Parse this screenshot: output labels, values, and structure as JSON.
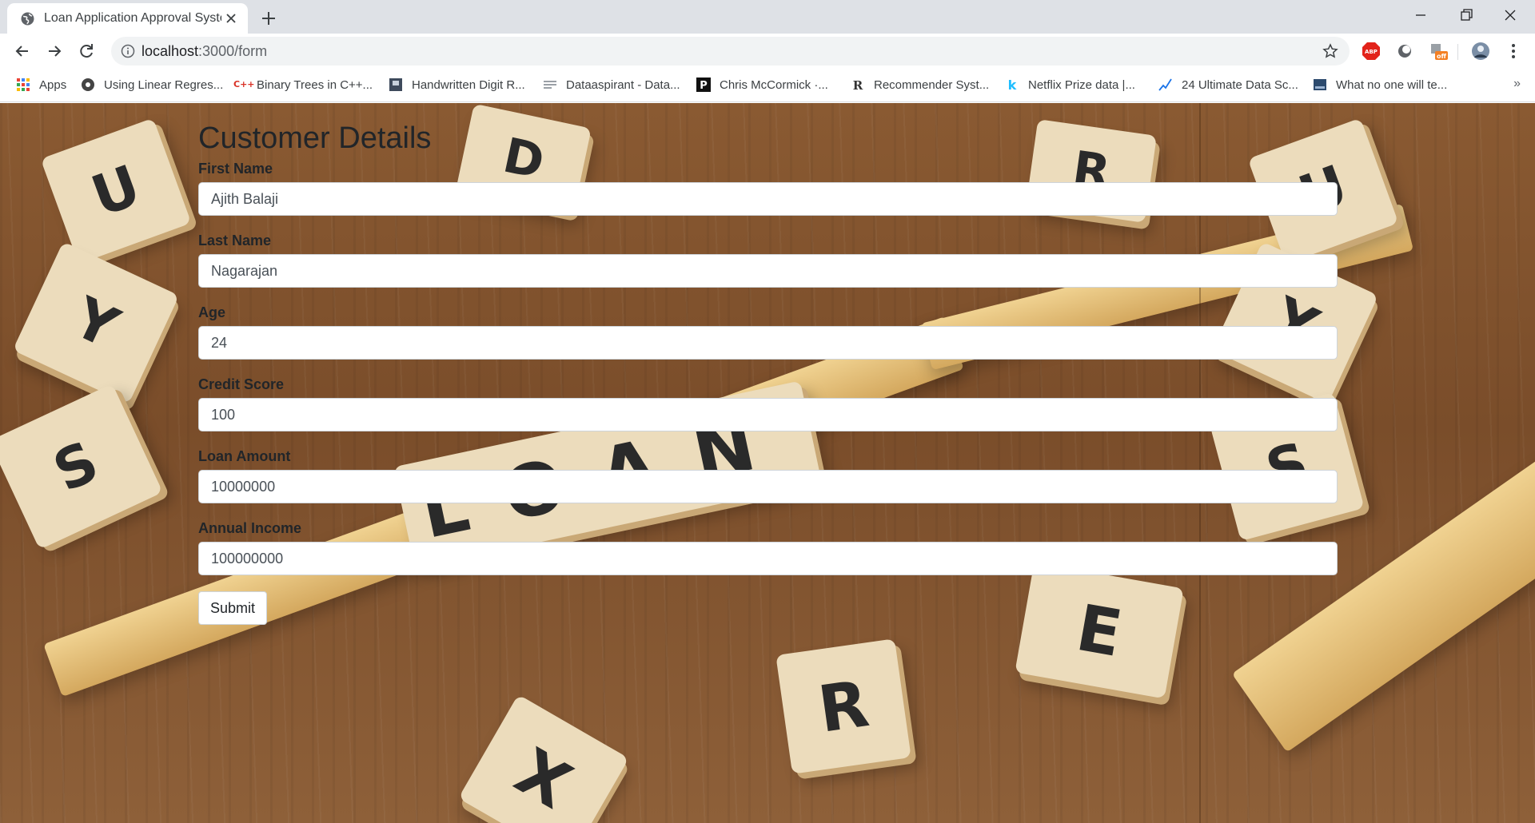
{
  "browser": {
    "tab_title": "Loan Application Approval System",
    "url_host": "localhost",
    "url_path": ":3000/form",
    "bookmarks": [
      {
        "label": "Apps",
        "icon": "apps-grid-icon"
      },
      {
        "label": "Using Linear Regres...",
        "icon": "site-favicon-icon"
      },
      {
        "label": "Binary Trees in C++...",
        "icon": "cpp-favicon-icon"
      },
      {
        "label": "Handwritten Digit R...",
        "icon": "site-favicon-icon"
      },
      {
        "label": "Dataaspirant - Data...",
        "icon": "site-favicon-icon"
      },
      {
        "label": "Chris McCormick ·...",
        "icon": "p-favicon-icon"
      },
      {
        "label": "Recommender Syst...",
        "icon": "r-favicon-icon"
      },
      {
        "label": "Netflix Prize data |...",
        "icon": "kaggle-favicon-icon"
      },
      {
        "label": "24 Ultimate Data Sc...",
        "icon": "chart-favicon-icon"
      },
      {
        "label": "What no one will te...",
        "icon": "site-favicon-icon"
      }
    ],
    "more_bookmarks": "»"
  },
  "form": {
    "heading": "Customer Details",
    "fields": [
      {
        "label": "First Name",
        "value": "Ajith Balaji"
      },
      {
        "label": "Last Name",
        "value": "Nagarajan"
      },
      {
        "label": "Age",
        "value": "24"
      },
      {
        "label": "Credit Score",
        "value": "100"
      },
      {
        "label": "Loan Amount",
        "value": "10000000"
      },
      {
        "label": "Annual Income",
        "value": "100000000"
      }
    ],
    "submit_label": "Submit"
  },
  "colors": {
    "tabstrip": "#dee1e6",
    "text": "#212529",
    "background_wood": "#7a4d2a"
  }
}
